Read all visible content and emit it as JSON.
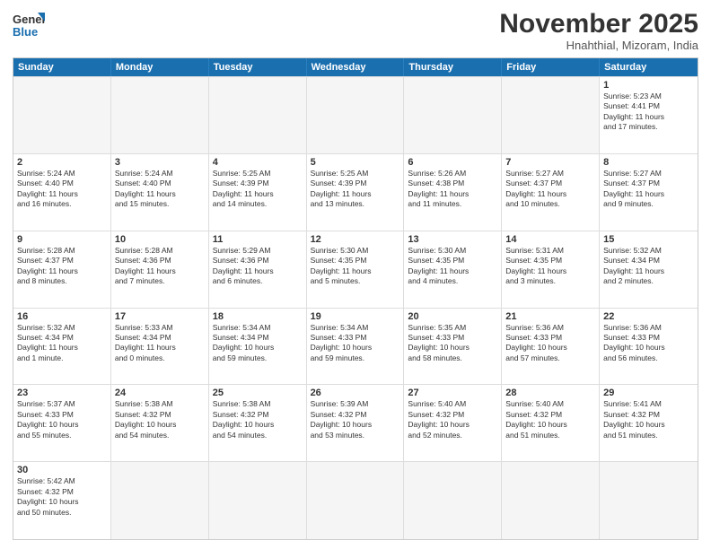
{
  "header": {
    "logo_general": "General",
    "logo_blue": "Blue",
    "month_title": "November 2025",
    "location": "Hnahthial, Mizoram, India"
  },
  "days_of_week": [
    "Sunday",
    "Monday",
    "Tuesday",
    "Wednesday",
    "Thursday",
    "Friday",
    "Saturday"
  ],
  "weeks": [
    [
      {
        "day": "",
        "info": "",
        "empty": true
      },
      {
        "day": "",
        "info": "",
        "empty": true
      },
      {
        "day": "",
        "info": "",
        "empty": true
      },
      {
        "day": "",
        "info": "",
        "empty": true
      },
      {
        "day": "",
        "info": "",
        "empty": true
      },
      {
        "day": "",
        "info": "",
        "empty": true
      },
      {
        "day": "1",
        "info": "Sunrise: 5:23 AM\nSunset: 4:41 PM\nDaylight: 11 hours\nand 17 minutes.",
        "empty": false
      }
    ],
    [
      {
        "day": "2",
        "info": "Sunrise: 5:24 AM\nSunset: 4:40 PM\nDaylight: 11 hours\nand 16 minutes.",
        "empty": false
      },
      {
        "day": "3",
        "info": "Sunrise: 5:24 AM\nSunset: 4:40 PM\nDaylight: 11 hours\nand 15 minutes.",
        "empty": false
      },
      {
        "day": "4",
        "info": "Sunrise: 5:25 AM\nSunset: 4:39 PM\nDaylight: 11 hours\nand 14 minutes.",
        "empty": false
      },
      {
        "day": "5",
        "info": "Sunrise: 5:25 AM\nSunset: 4:39 PM\nDaylight: 11 hours\nand 13 minutes.",
        "empty": false
      },
      {
        "day": "6",
        "info": "Sunrise: 5:26 AM\nSunset: 4:38 PM\nDaylight: 11 hours\nand 11 minutes.",
        "empty": false
      },
      {
        "day": "7",
        "info": "Sunrise: 5:27 AM\nSunset: 4:37 PM\nDaylight: 11 hours\nand 10 minutes.",
        "empty": false
      },
      {
        "day": "8",
        "info": "Sunrise: 5:27 AM\nSunset: 4:37 PM\nDaylight: 11 hours\nand 9 minutes.",
        "empty": false
      }
    ],
    [
      {
        "day": "9",
        "info": "Sunrise: 5:28 AM\nSunset: 4:37 PM\nDaylight: 11 hours\nand 8 minutes.",
        "empty": false
      },
      {
        "day": "10",
        "info": "Sunrise: 5:28 AM\nSunset: 4:36 PM\nDaylight: 11 hours\nand 7 minutes.",
        "empty": false
      },
      {
        "day": "11",
        "info": "Sunrise: 5:29 AM\nSunset: 4:36 PM\nDaylight: 11 hours\nand 6 minutes.",
        "empty": false
      },
      {
        "day": "12",
        "info": "Sunrise: 5:30 AM\nSunset: 4:35 PM\nDaylight: 11 hours\nand 5 minutes.",
        "empty": false
      },
      {
        "day": "13",
        "info": "Sunrise: 5:30 AM\nSunset: 4:35 PM\nDaylight: 11 hours\nand 4 minutes.",
        "empty": false
      },
      {
        "day": "14",
        "info": "Sunrise: 5:31 AM\nSunset: 4:35 PM\nDaylight: 11 hours\nand 3 minutes.",
        "empty": false
      },
      {
        "day": "15",
        "info": "Sunrise: 5:32 AM\nSunset: 4:34 PM\nDaylight: 11 hours\nand 2 minutes.",
        "empty": false
      }
    ],
    [
      {
        "day": "16",
        "info": "Sunrise: 5:32 AM\nSunset: 4:34 PM\nDaylight: 11 hours\nand 1 minute.",
        "empty": false
      },
      {
        "day": "17",
        "info": "Sunrise: 5:33 AM\nSunset: 4:34 PM\nDaylight: 11 hours\nand 0 minutes.",
        "empty": false
      },
      {
        "day": "18",
        "info": "Sunrise: 5:34 AM\nSunset: 4:34 PM\nDaylight: 10 hours\nand 59 minutes.",
        "empty": false
      },
      {
        "day": "19",
        "info": "Sunrise: 5:34 AM\nSunset: 4:33 PM\nDaylight: 10 hours\nand 59 minutes.",
        "empty": false
      },
      {
        "day": "20",
        "info": "Sunrise: 5:35 AM\nSunset: 4:33 PM\nDaylight: 10 hours\nand 58 minutes.",
        "empty": false
      },
      {
        "day": "21",
        "info": "Sunrise: 5:36 AM\nSunset: 4:33 PM\nDaylight: 10 hours\nand 57 minutes.",
        "empty": false
      },
      {
        "day": "22",
        "info": "Sunrise: 5:36 AM\nSunset: 4:33 PM\nDaylight: 10 hours\nand 56 minutes.",
        "empty": false
      }
    ],
    [
      {
        "day": "23",
        "info": "Sunrise: 5:37 AM\nSunset: 4:33 PM\nDaylight: 10 hours\nand 55 minutes.",
        "empty": false
      },
      {
        "day": "24",
        "info": "Sunrise: 5:38 AM\nSunset: 4:32 PM\nDaylight: 10 hours\nand 54 minutes.",
        "empty": false
      },
      {
        "day": "25",
        "info": "Sunrise: 5:38 AM\nSunset: 4:32 PM\nDaylight: 10 hours\nand 54 minutes.",
        "empty": false
      },
      {
        "day": "26",
        "info": "Sunrise: 5:39 AM\nSunset: 4:32 PM\nDaylight: 10 hours\nand 53 minutes.",
        "empty": false
      },
      {
        "day": "27",
        "info": "Sunrise: 5:40 AM\nSunset: 4:32 PM\nDaylight: 10 hours\nand 52 minutes.",
        "empty": false
      },
      {
        "day": "28",
        "info": "Sunrise: 5:40 AM\nSunset: 4:32 PM\nDaylight: 10 hours\nand 51 minutes.",
        "empty": false
      },
      {
        "day": "29",
        "info": "Sunrise: 5:41 AM\nSunset: 4:32 PM\nDaylight: 10 hours\nand 51 minutes.",
        "empty": false
      }
    ],
    [
      {
        "day": "30",
        "info": "Sunrise: 5:42 AM\nSunset: 4:32 PM\nDaylight: 10 hours\nand 50 minutes.",
        "empty": false
      },
      {
        "day": "",
        "info": "",
        "empty": true
      },
      {
        "day": "",
        "info": "",
        "empty": true
      },
      {
        "day": "",
        "info": "",
        "empty": true
      },
      {
        "day": "",
        "info": "",
        "empty": true
      },
      {
        "day": "",
        "info": "",
        "empty": true
      },
      {
        "day": "",
        "info": "",
        "empty": true
      }
    ]
  ]
}
